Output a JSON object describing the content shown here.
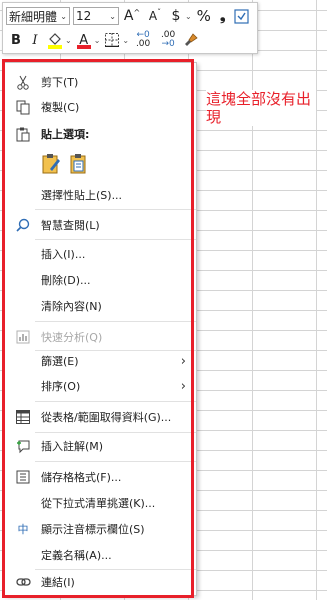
{
  "toolbar": {
    "font_name": "新細明體",
    "font_size": "12",
    "grow_font": "A",
    "shrink_font": "A",
    "currency": "$",
    "percent": "%",
    "comma": "❟",
    "bold": "B",
    "italic": "I",
    "font_color_letter": "A",
    "dec_increase_top": "←0",
    "dec_increase_bottom": ".00",
    "dec_decrease_top": ".00",
    "dec_decrease_bottom": "→0"
  },
  "menu": {
    "items": [
      {
        "label": "剪下(T)",
        "icon": "scissors-icon"
      },
      {
        "label": "複製(C)",
        "icon": "copy-icon"
      },
      {
        "label": "貼上選項:",
        "icon": "paste-icon"
      },
      {
        "label": "選擇性貼上(S)...",
        "icon": ""
      },
      {
        "label": "智慧查閱(L)",
        "icon": "smart-lookup-icon"
      },
      {
        "label": "插入(I)...",
        "icon": ""
      },
      {
        "label": "刪除(D)...",
        "icon": ""
      },
      {
        "label": "清除內容(N)",
        "icon": ""
      },
      {
        "label": "快速分析(Q)",
        "icon": "quick-analysis-icon",
        "disabled": true
      },
      {
        "label": "篩選(E)",
        "icon": "",
        "submenu": true
      },
      {
        "label": "排序(O)",
        "icon": "",
        "submenu": true
      },
      {
        "label": "從表格/範圍取得資料(G)...",
        "icon": "table-icon"
      },
      {
        "label": "插入註解(M)",
        "icon": "comment-icon"
      },
      {
        "label": "儲存格格式(F)...",
        "icon": "format-cells-icon"
      },
      {
        "label": "從下拉式清單挑選(K)...",
        "icon": ""
      },
      {
        "label": "顯示注音標示欄位(S)",
        "icon": "phonetic-icon"
      },
      {
        "label": "定義名稱(A)...",
        "icon": ""
      },
      {
        "label": "連結(I)",
        "icon": "link-icon"
      }
    ],
    "submenu_arrow": "›",
    "phonetic_glyph": "中"
  },
  "annotation": {
    "note": "這塊全部沒有出現",
    "color": "#e8202a"
  },
  "colors": {
    "highlight_swatch": "#ffff00",
    "font_color_swatch": "#e8202a"
  }
}
